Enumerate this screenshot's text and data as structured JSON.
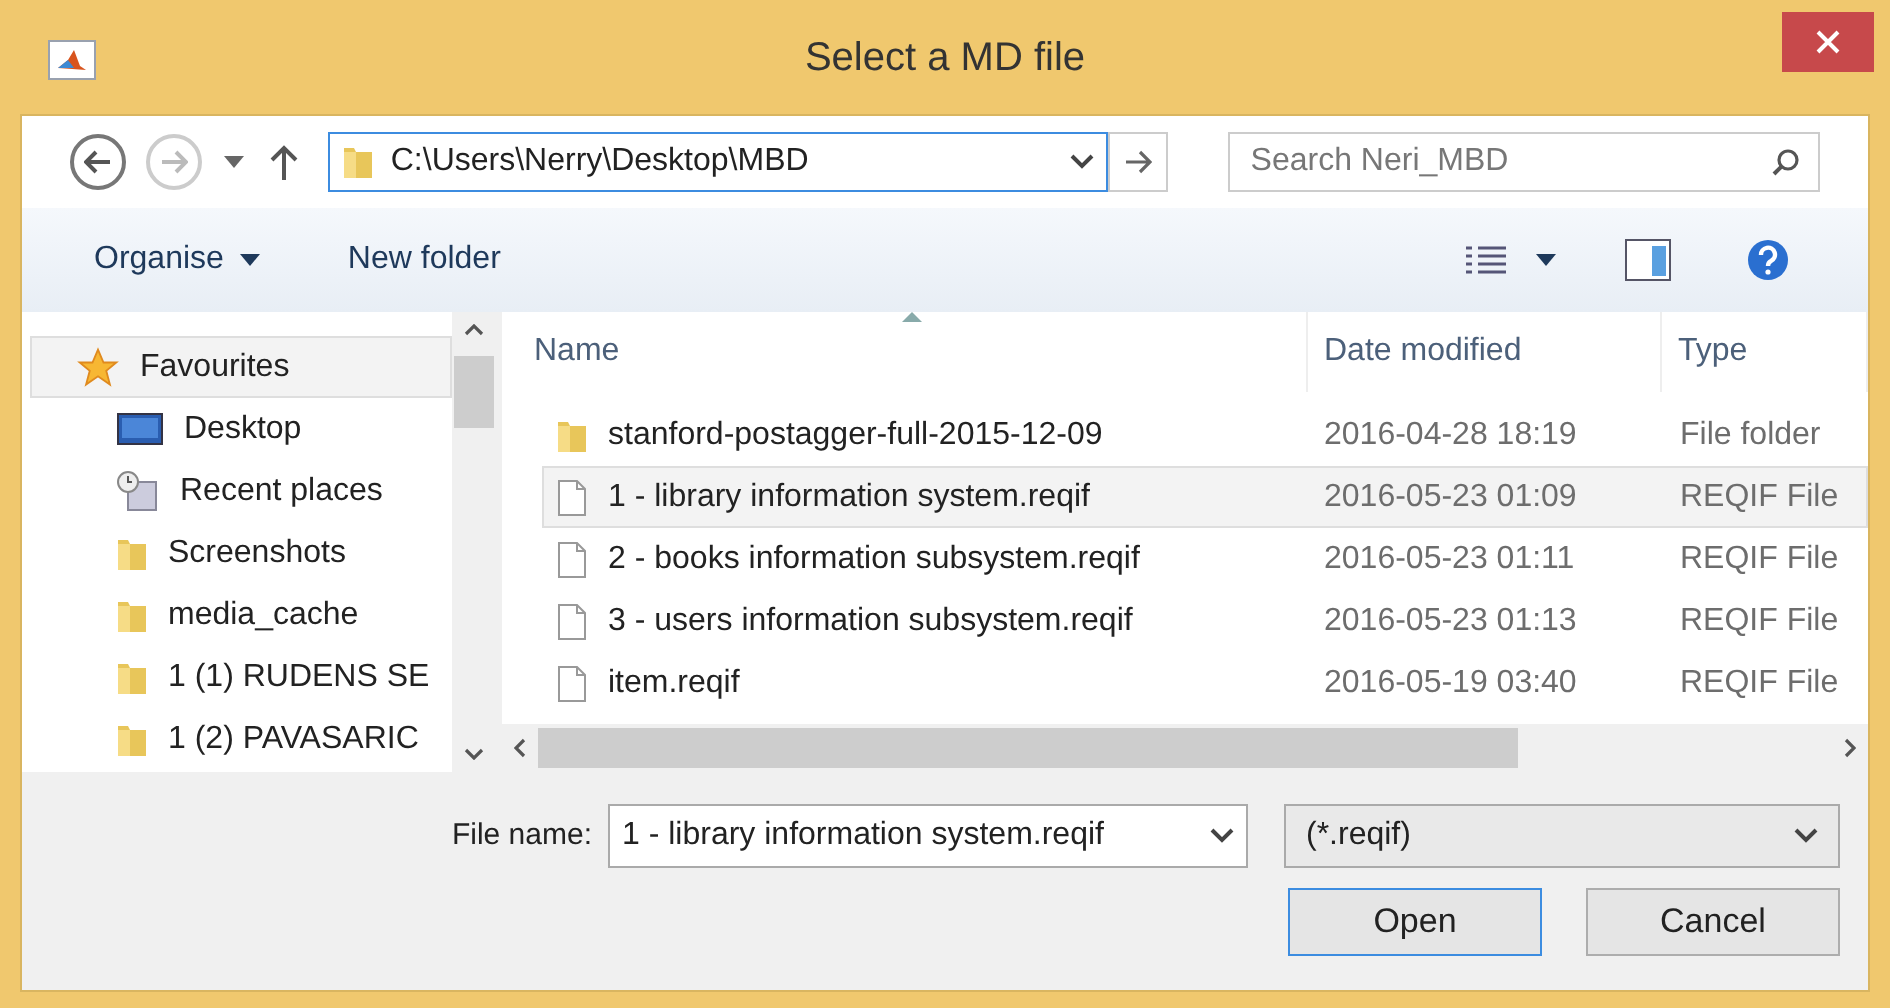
{
  "window": {
    "title": "Select a MD file"
  },
  "address": {
    "path": "C:\\Users\\Nerry\\Desktop\\MBD"
  },
  "search": {
    "placeholder": "Search Neri_MBD"
  },
  "toolbar": {
    "organise": "Organise",
    "new_folder": "New folder"
  },
  "sidebar": {
    "items": [
      {
        "label": "Favourites",
        "kind": "star",
        "selected": true
      },
      {
        "label": "Desktop",
        "kind": "desktop",
        "selected": false
      },
      {
        "label": "Recent places",
        "kind": "recent",
        "selected": false
      },
      {
        "label": "Screenshots",
        "kind": "folder",
        "selected": false
      },
      {
        "label": "media_cache",
        "kind": "folder",
        "selected": false
      },
      {
        "label": "1 (1)  RUDENS SE",
        "kind": "folder",
        "selected": false
      },
      {
        "label": "1 (2)  PAVASARIC",
        "kind": "folder",
        "selected": false
      }
    ]
  },
  "table": {
    "columns": [
      "Name",
      "Date modified",
      "Type"
    ],
    "rows": [
      {
        "name": "stanford-postagger-full-2015-12-09",
        "date": "2016-04-28 18:19",
        "type": "File folder",
        "kind": "folder",
        "selected": false
      },
      {
        "name": "1 - library information system.reqif",
        "date": "2016-05-23 01:09",
        "type": "REQIF File",
        "kind": "file",
        "selected": true
      },
      {
        "name": "2 - books information subsystem.reqif",
        "date": "2016-05-23 01:11",
        "type": "REQIF File",
        "kind": "file",
        "selected": false
      },
      {
        "name": "3 - users information subsystem.reqif",
        "date": "2016-05-23 01:13",
        "type": "REQIF File",
        "kind": "file",
        "selected": false
      },
      {
        "name": "item.reqif",
        "date": "2016-05-19 03:40",
        "type": "REQIF File",
        "kind": "file",
        "selected": false
      }
    ]
  },
  "file_name": {
    "label": "File name:",
    "value": "1 - library information system.reqif"
  },
  "file_type": {
    "value": "(*.reqif)"
  },
  "buttons": [
    "Open",
    "Cancel"
  ]
}
